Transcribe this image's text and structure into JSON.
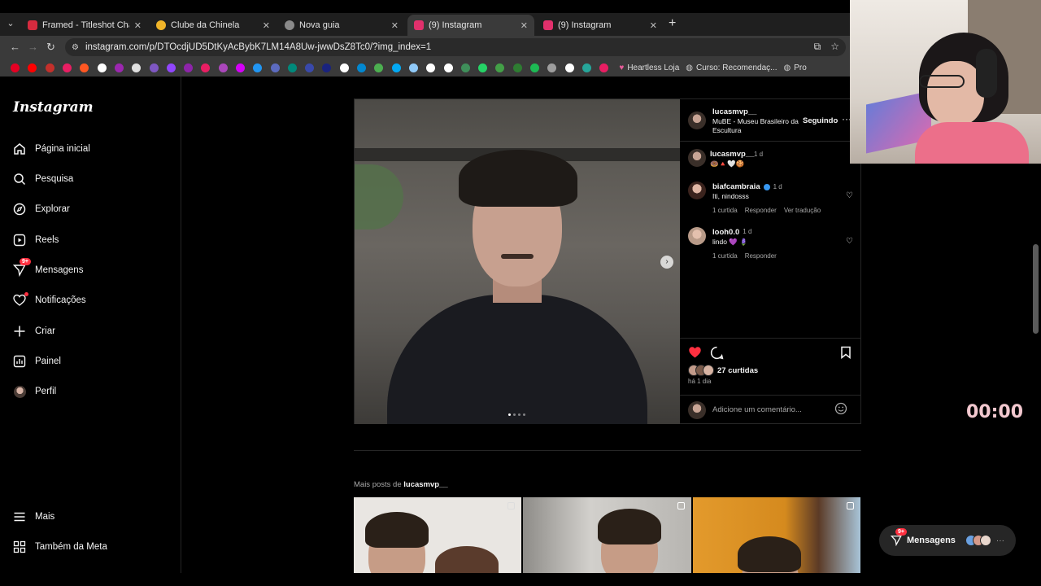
{
  "browser": {
    "tabs": [
      {
        "title": "Framed - Titleshot Challenge",
        "icon": "framed-icon",
        "color": "#d62b3f"
      },
      {
        "title": "Clube da Chinela",
        "icon": "chrome-icon",
        "color": "#f0b429"
      },
      {
        "title": "Nova guia",
        "icon": "chrome-icon",
        "color": "#8a8a8a"
      },
      {
        "title": "(9) Instagram",
        "icon": "instagram-icon",
        "color": "#e1306c"
      },
      {
        "title": "(9) Instagram",
        "icon": "instagram-icon",
        "color": "#e1306c"
      }
    ],
    "url": "instagram.com/p/DTOcdjUD5DtKyAcBybK7LM14A8Uw-jwwDsZ8Tc0/?img_index=1",
    "bookmark_colors": [
      "#e60023",
      "#ff0000",
      "#c4302b",
      "#e91e63",
      "#ff5722",
      "#ffffff",
      "#9c27b0",
      "#e0e0e0",
      "#7e57c2",
      "#9146ff",
      "#8e24aa",
      "#e91e63",
      "#ab47bc",
      "#d500f9",
      "#2196f3",
      "#5c6bc0",
      "#00897b",
      "#3949ab",
      "#1a237e",
      "#ffffff",
      "#0288d1",
      "#4caf50",
      "#03a9f4",
      "#90caf9",
      "#ffffff",
      "#ffffff",
      "#3f8f5a",
      "#25d366",
      "#43a047",
      "#2e7d32",
      "#1db954",
      "#9e9e9e",
      "#ffffff",
      "#26a69a",
      "#e91e63"
    ],
    "bookmarks_text": [
      {
        "label": "Heartless Loja",
        "icon": "heart-icon"
      },
      {
        "label": "Curso: Recomendaç...",
        "icon": "globe-icon"
      },
      {
        "label": "Pro",
        "icon": "profile-icon"
      }
    ]
  },
  "sidebar": {
    "logo": "Instagram",
    "items": [
      {
        "label": "Página inicial",
        "icon": "home-icon"
      },
      {
        "label": "Pesquisa",
        "icon": "search-icon"
      },
      {
        "label": "Explorar",
        "icon": "compass-icon"
      },
      {
        "label": "Reels",
        "icon": "reels-icon"
      },
      {
        "label": "Mensagens",
        "icon": "messenger-icon",
        "badge": "9+"
      },
      {
        "label": "Notificações",
        "icon": "heart-icon",
        "dot": true
      },
      {
        "label": "Criar",
        "icon": "plus-icon"
      },
      {
        "label": "Painel",
        "icon": "dashboard-icon"
      },
      {
        "label": "Perfil",
        "icon": "avatar-icon"
      }
    ],
    "bottom_items": [
      {
        "label": "Mais",
        "icon": "menu-icon"
      },
      {
        "label": "Também da Meta",
        "icon": "meta-icon"
      }
    ]
  },
  "post": {
    "author": "lucasmvp__",
    "location": "MuBE - Museu Brasileiro da Escultura",
    "follow_label": "Seguindo",
    "caption_time": "1 d",
    "caption_emojis": "🍩🔺🤍🍪",
    "comments": [
      {
        "user": "biafcambraia",
        "verified": true,
        "time": "1 d",
        "text": "Iti, nindosss",
        "likes": "1 curtida",
        "reply": "Responder",
        "translate": "Ver tradução"
      },
      {
        "user": "looh0.0",
        "verified": false,
        "time": "1 d",
        "text": "lindo 💜 🪻",
        "likes": "1 curtida",
        "reply": "Responder"
      }
    ],
    "likes": "27 curtidas",
    "posted": "há 1 dia",
    "add_comment_placeholder": "Adicione um comentário...",
    "carousel_count": 4,
    "carousel_index": 1
  },
  "more": {
    "prefix": "Mais posts de",
    "user": "lucasmvp__"
  },
  "timer": "00:00",
  "messages_pill": {
    "label": "Mensagens",
    "badge": "9+",
    "more": "···"
  }
}
